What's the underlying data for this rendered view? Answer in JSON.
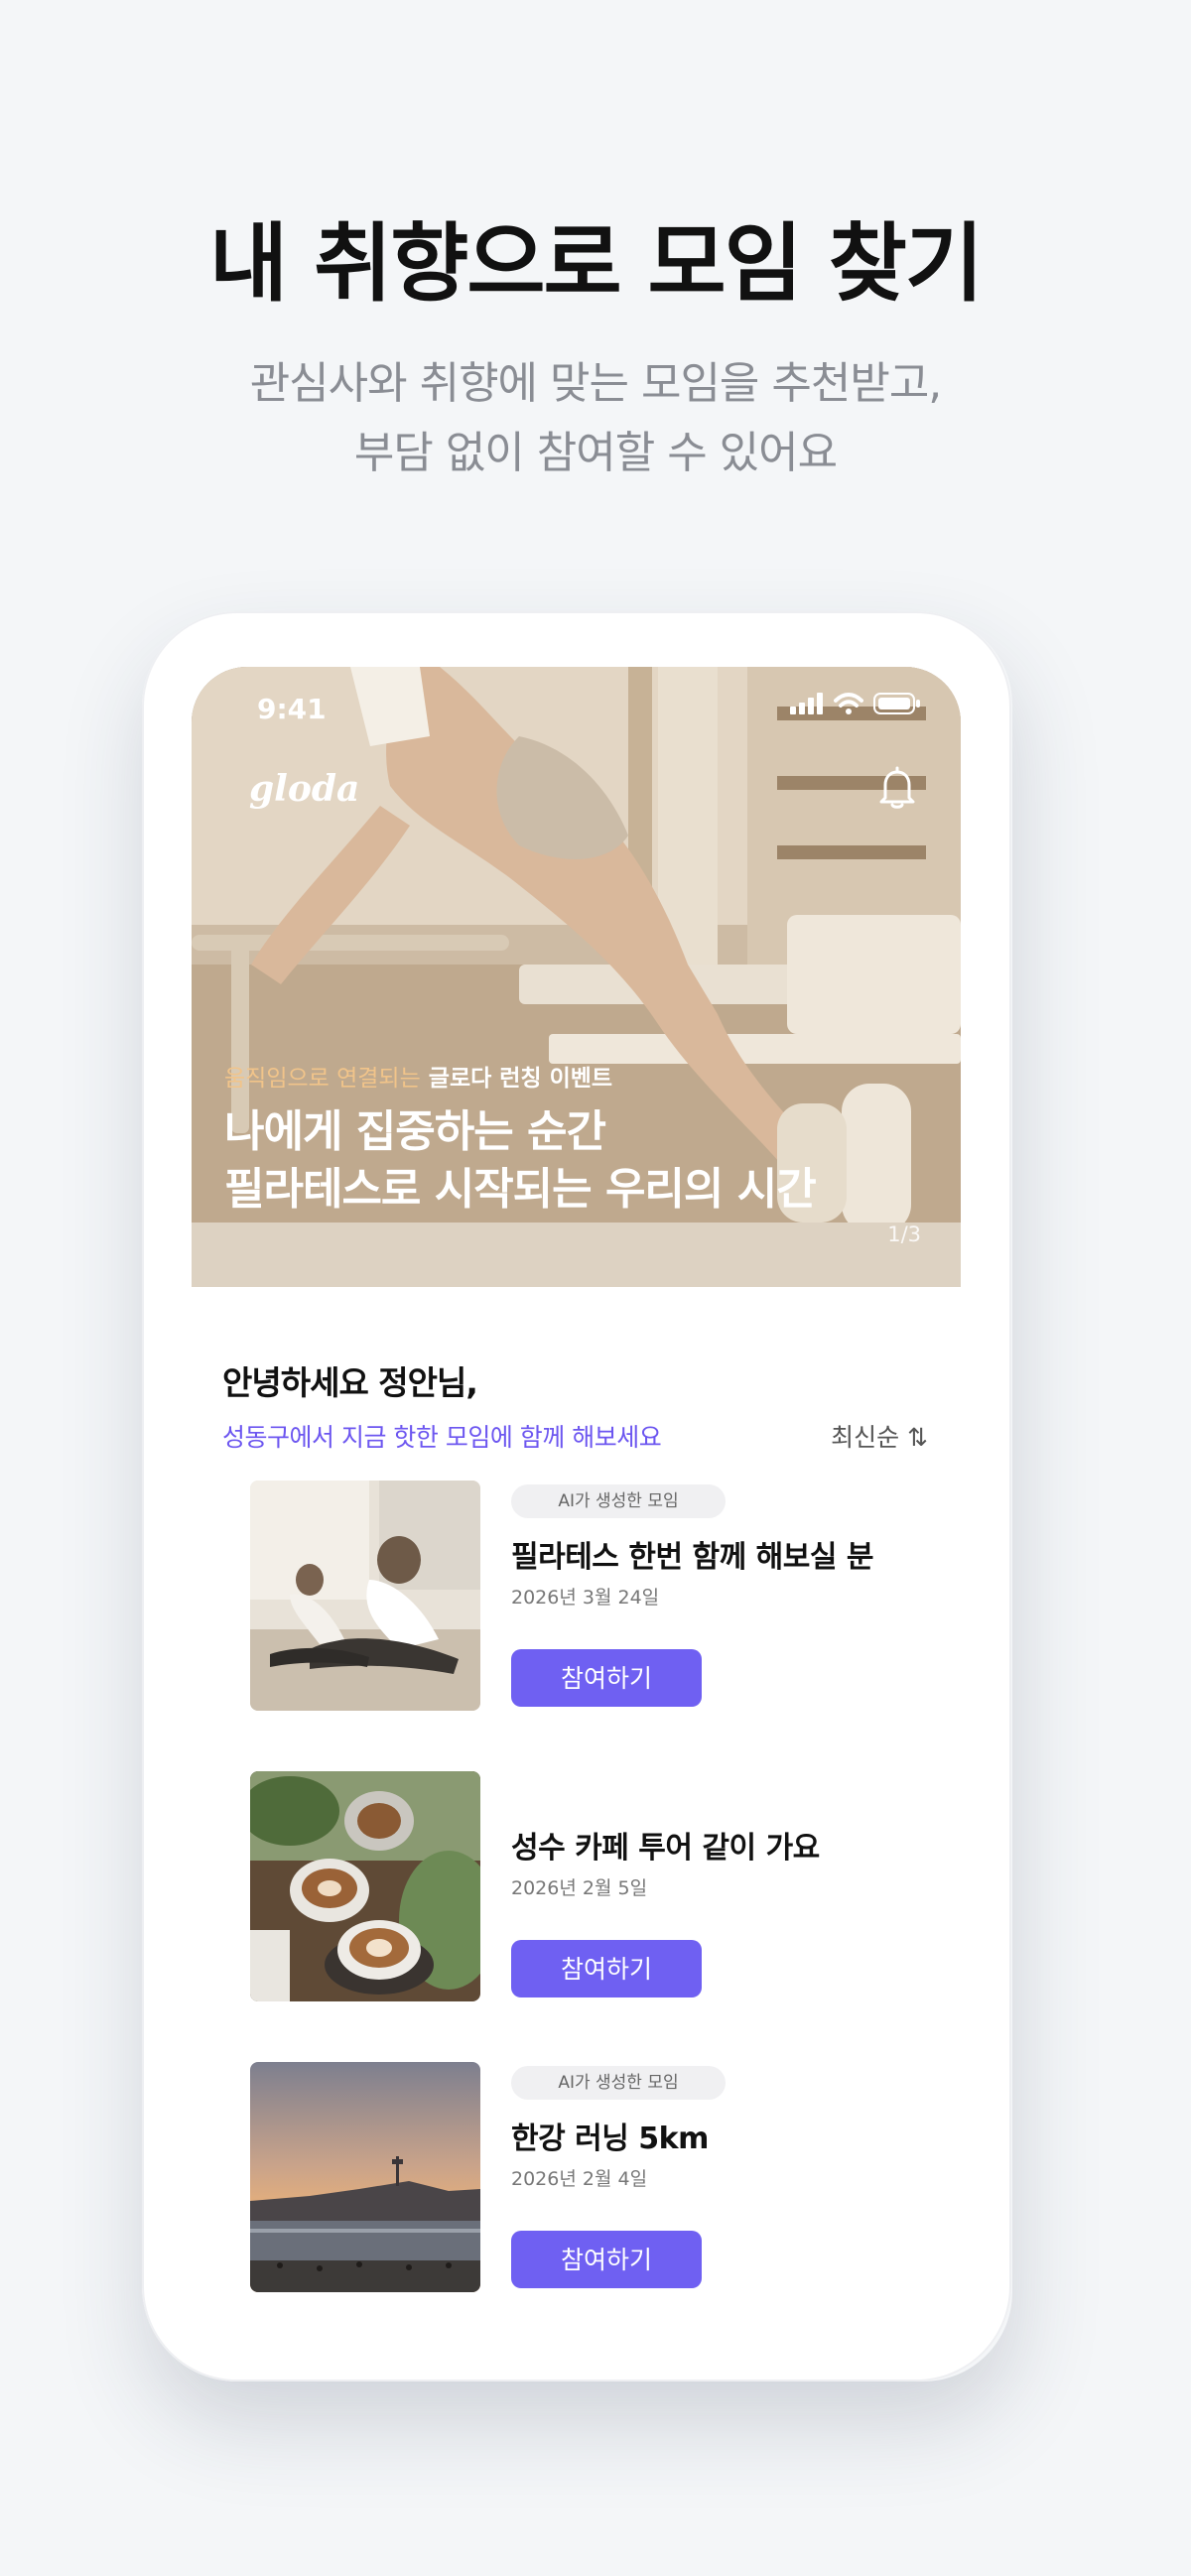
{
  "promo": {
    "headline": "내 취향으로 모임 찾기",
    "subline_1": "관심사와 취향에 맞는 모임을 추천받고,",
    "subline_2": "부담 없이 참여할 수 있어요"
  },
  "status_bar": {
    "time": "9:41"
  },
  "app": {
    "logo": "gloda"
  },
  "hero": {
    "kicker_accent": "움직임으로 연결되는",
    "kicker_main": "글로다 런칭 이벤트",
    "title_line_1": "나에게 집중하는 순간",
    "title_line_2": "필라테스로 시작되는 우리의 시간",
    "page_indicator": "1/3"
  },
  "feed": {
    "greeting": "안녕하세요 정안님,",
    "subtitle": "성동구에서 지금 핫한 모임에 함께 해보세요",
    "sort_label": "최신순 ⇅"
  },
  "meetups": [
    {
      "badge": "AI가 생성한 모임",
      "title": "필라테스 한번 함께 해보실 분",
      "date": "2026년 3월 24일",
      "button": "참여하기"
    },
    {
      "badge": "",
      "title": "성수 카페 투어 같이 가요",
      "date": "2026년 2월 5일",
      "button": "참여하기"
    },
    {
      "badge": "AI가 생성한 모임",
      "title": "한강 러닝 5km",
      "date": "2026년 2월 4일",
      "button": "참여하기"
    }
  ],
  "colors": {
    "accent": "#6f60f2",
    "kicker_accent": "#f1c48a",
    "background": "#f4f6f8"
  },
  "icons": {
    "bell": "bell-icon",
    "signal": "signal-icon",
    "wifi": "wifi-icon",
    "battery": "battery-icon"
  }
}
